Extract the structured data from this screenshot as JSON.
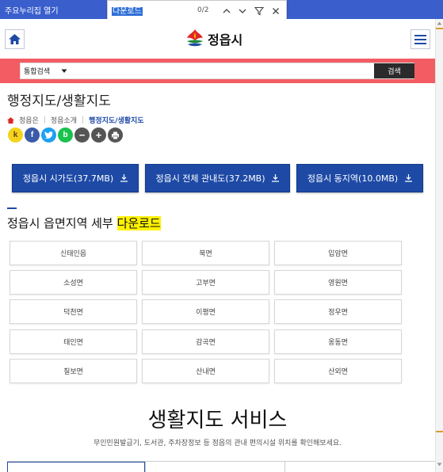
{
  "topbar": {
    "link": "주요누리집 열기"
  },
  "find": {
    "query": "다운로드",
    "count": "0/2"
  },
  "header": {
    "logo_text": "정읍시"
  },
  "search": {
    "scope": "통합검색",
    "button": "검색"
  },
  "page": {
    "title": "행정지도/생활지도",
    "breadcrumb": [
      "정읍은",
      "정읍소개",
      "행정지도/생활지도"
    ]
  },
  "share": [
    {
      "label": "k",
      "color": "#f5d31a",
      "name": "kakaostory-share-icon"
    },
    {
      "label": "f",
      "color": "#3b5ba8",
      "name": "facebook-share-icon"
    },
    {
      "label": "t",
      "color": "#1da1f2",
      "name": "twitter-share-icon"
    },
    {
      "label": "b",
      "color": "#19c24d",
      "name": "blog-share-icon"
    },
    {
      "label": "−",
      "color": "#555555",
      "name": "zoom-out-icon"
    },
    {
      "label": "+",
      "color": "#555555",
      "name": "zoom-in-icon"
    },
    {
      "label": "",
      "color": "#555555",
      "name": "print-icon"
    }
  ],
  "downloads": [
    "정읍시 시가도(37.7MB)",
    "정읍시 전체 관내도(37.2MB)",
    "정읍시 동지역(10.0MB)"
  ],
  "section": {
    "title_prefix": "정읍시 읍면지역 세부 ",
    "title_highlight": "다운로드"
  },
  "districts": [
    "신태인읍",
    "북면",
    "입암면",
    "소성면",
    "고부면",
    "영원면",
    "덕천면",
    "이평면",
    "정우면",
    "태인면",
    "감곡면",
    "옹동면",
    "칠보면",
    "산내면",
    "산외면"
  ],
  "service": {
    "title": "생활지도 서비스",
    "description": "무인민원발급기, 도서관, 주차장정보 등 정읍의 관내 편의시설 위치를 확인해보세요."
  },
  "colors": {
    "primary": "#1e4aa6",
    "search_band": "#f35c63",
    "highlight": "#fff200"
  }
}
